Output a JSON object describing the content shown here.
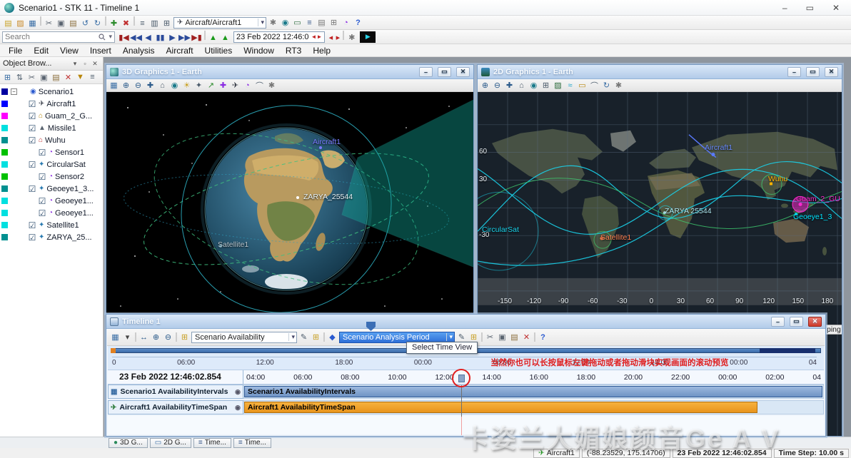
{
  "window": {
    "title": "Scenario1 - STK 11 - Timeline 1"
  },
  "icons": {
    "minimize": "–",
    "maximize": "▭",
    "close": "✕",
    "caret": "▾",
    "aircraft": "✈",
    "search": "Search"
  },
  "menu": {
    "items": [
      "File",
      "Edit",
      "View",
      "Insert",
      "Analysis",
      "Aircraft",
      "Utilities",
      "Window",
      "RT3",
      "Help"
    ]
  },
  "toolbar_top": {
    "object_selector": "Aircraft/Aircraft1",
    "icons_a": [
      {
        "n": "new-scenario-icon",
        "g": "▤",
        "s": "color:#c9a227"
      },
      {
        "n": "open-icon",
        "g": "▨",
        "s": "color:#c98a2a"
      },
      {
        "n": "save-icon",
        "g": "▦",
        "s": "color:#3a6ea5"
      },
      {
        "n": "separator",
        "g": "",
        "s": "min-width:2px;width:2px;height:13px;background:#cdcdcd;margin:0 2px",
        "i": "false"
      },
      {
        "n": "cut-icon",
        "g": "✂",
        "s": "color:#5a6470"
      },
      {
        "n": "copy-icon",
        "g": "▣",
        "s": "color:#5a6470"
      },
      {
        "n": "paste-icon",
        "g": "▤",
        "s": "color:#8a6d3b"
      },
      {
        "n": "undo-icon",
        "g": "↺",
        "s": "color:#3a6ea5"
      },
      {
        "n": "redo-icon",
        "g": "↻",
        "s": "color:#3a6ea5"
      },
      {
        "n": "separator",
        "g": "",
        "s": "min-width:2px;width:2px;height:13px;background:#cdcdcd;margin:0 2px",
        "i": "false"
      },
      {
        "n": "new-object-icon",
        "g": "✚",
        "s": "color:#2a8a2a"
      },
      {
        "n": "delete-object-icon",
        "g": "✖",
        "s": "color:#c03030"
      },
      {
        "n": "separator",
        "g": "",
        "s": "min-width:2px;width:2px;height:13px;background:#cdcdcd;margin:0 2px",
        "i": "false"
      },
      {
        "n": "report-icon",
        "g": "≡",
        "s": "color:#4a5a6a"
      },
      {
        "n": "graph-icon",
        "g": "▥",
        "s": "color:#4a5a6a"
      },
      {
        "n": "browser-icon",
        "g": "⊞",
        "s": "color:#4a5a6a"
      }
    ],
    "icons_b": [
      {
        "n": "properties-icon",
        "g": "✱",
        "s": "color:#777"
      },
      {
        "n": "3d-graphics-icon",
        "g": "◉",
        "s": "color:#1a7a8a"
      },
      {
        "n": "2d-graphics-icon",
        "g": "▭",
        "s": "color:#2a6a3a"
      },
      {
        "n": "timeline-window-icon",
        "g": "≡",
        "s": "color:#3a5a8a"
      },
      {
        "n": "report-manager-icon",
        "g": "▤",
        "s": "color:#777"
      },
      {
        "n": "data-provider-icon",
        "g": "⊞",
        "s": "color:#777"
      },
      {
        "n": "sensor-manager-icon",
        "g": "◔",
        "s": "color:#8a2be2"
      },
      {
        "n": "help-icon",
        "g": "?",
        "s": "color:#2a5ad0;font-weight:bold"
      }
    ]
  },
  "toolbar_anim": {
    "search_value": "Search",
    "time_field": "23 Feb 2022 12:46:0",
    "vcr": [
      {
        "n": "animation-reset-icon",
        "g": "▮◀",
        "s": "color:#a02020"
      },
      {
        "n": "step-back-icon",
        "g": "◀◀",
        "s": "color:#2a4a9a"
      },
      {
        "n": "play-backward-icon",
        "g": "◀",
        "s": "color:#2a4a9a"
      },
      {
        "n": "pause-icon",
        "g": "▮▮",
        "s": "color:#2a4a9a"
      },
      {
        "n": "play-icon",
        "g": "▶",
        "s": "color:#2a4a9a"
      },
      {
        "n": "step-forward-icon",
        "g": "▶▶",
        "s": "color:#2a4a9a"
      },
      {
        "n": "animation-end-icon",
        "g": "▶▮",
        "s": "color:#a02020"
      },
      {
        "n": "separator",
        "g": "",
        "s": "min-width:2px;width:2px;height:13px;background:#cdcdcd;margin:0 2px",
        "i": "false"
      },
      {
        "n": "decrease-step-icon",
        "g": "▲",
        "s": "color:#1a9a1a"
      },
      {
        "n": "increase-step-icon",
        "g": "▲",
        "s": "color:#1a9a1a"
      }
    ],
    "icons_c": [
      {
        "n": "time-step-down-icon",
        "g": "◂",
        "s": "color:#c02020;min-width:10px"
      },
      {
        "n": "time-step-up-icon",
        "g": "▸",
        "s": "color:#c02020;min-width:10px"
      },
      {
        "n": "separator",
        "g": "",
        "s": "min-width:2px;width:2px;height:13px;background:#cdcdcd;margin:0 2px",
        "i": "false"
      },
      {
        "n": "animation-options-icon",
        "g": "✱",
        "s": "color:#777"
      }
    ]
  },
  "object_browser": {
    "title": "Object Brow...",
    "head_icons": [
      {
        "n": "dock-menu-icon",
        "g": "▾"
      },
      {
        "n": "pin-icon",
        "g": "▫"
      },
      {
        "n": "close-icon",
        "g": "✕"
      }
    ],
    "toolbar_icons": [
      {
        "n": "view-mode-icon",
        "g": "⊞",
        "s": "color:#3a6ea5"
      },
      {
        "n": "sort-icon",
        "g": "⇅",
        "s": "color:#4a5a6a"
      },
      {
        "n": "cut-icon",
        "g": "✂",
        "s": "color:#5a6470"
      },
      {
        "n": "copy-icon",
        "g": "▣",
        "s": "color:#5a6470"
      },
      {
        "n": "paste-icon",
        "g": "▤",
        "s": "color:#8a6d3b"
      },
      {
        "n": "delete-icon",
        "g": "✕",
        "s": "color:#c03030"
      },
      {
        "n": "filter-icon",
        "g": "▼",
        "s": "color:#b8860b"
      },
      {
        "n": "list-icon",
        "g": "≡",
        "s": "color:#4a5a6a"
      }
    ],
    "tree": [
      {
        "label": "Scenario1",
        "exp": "−",
        "cb": "",
        "g": "◉",
        "gs": "color:#2a5ad0",
        "chip": "background:#0000a0",
        "pad": "padding-left:1px"
      },
      {
        "label": "Aircraft1",
        "exp": "",
        "cb": "☑",
        "g": "✈",
        "gs": "color:#3a3f4a",
        "chip": "background:#0000ff",
        "pad": "padding-left:13px"
      },
      {
        "label": "Guam_2_G...",
        "exp": "",
        "cb": "☑",
        "g": "⌂",
        "gs": "color:#b8860b",
        "chip": "background:#ff00ff",
        "pad": "padding-left:13px"
      },
      {
        "label": "Missile1",
        "exp": "",
        "cb": "☑",
        "g": "▲",
        "gs": "color:#5a6470",
        "chip": "background:#00e0e0",
        "pad": "padding-left:13px"
      },
      {
        "label": "Wuhu",
        "exp": "",
        "cb": "☑",
        "g": "⌂",
        "gs": "color:#c03030",
        "chip": "background:#009090",
        "pad": "padding-left:13px"
      },
      {
        "label": "Sensor1",
        "exp": "",
        "cb": "☑",
        "g": "◔",
        "gs": "color:#8a2be2",
        "chip": "background:#00c000",
        "pad": "padding-left:27px"
      },
      {
        "label": "CircularSat",
        "exp": "",
        "cb": "☑",
        "g": "✦",
        "gs": "color:#2a7ab0",
        "chip": "background:#00e0e0",
        "pad": "padding-left:13px"
      },
      {
        "label": "Sensor2",
        "exp": "",
        "cb": "☑",
        "g": "◔",
        "gs": "color:#8a2be2",
        "chip": "background:#00c000",
        "pad": "padding-left:27px"
      },
      {
        "label": "Geoeye1_3...",
        "exp": "",
        "cb": "☑",
        "g": "✦",
        "gs": "color:#2a7ab0",
        "chip": "background:#009090",
        "pad": "padding-left:13px"
      },
      {
        "label": "Geoeye1...",
        "exp": "",
        "cb": "☑",
        "g": "◔",
        "gs": "color:#8a2be2",
        "chip": "background:#00e0e0",
        "pad": "padding-left:27px"
      },
      {
        "label": "Geoeye1...",
        "exp": "",
        "cb": "☑",
        "g": "◔",
        "gs": "color:#8a2be2",
        "chip": "background:#00e0e0",
        "pad": "padding-left:27px"
      },
      {
        "label": "Satellite1",
        "exp": "",
        "cb": "☑",
        "g": "✦",
        "gs": "color:#2a7ab0",
        "chip": "background:#00e0e0",
        "pad": "padding-left:13px"
      },
      {
        "label": "ZARYA_25...",
        "exp": "",
        "cb": "☑",
        "g": "✦",
        "gs": "color:#2a7ab0",
        "chip": "background:#009090",
        "pad": "padding-left:13px"
      }
    ]
  },
  "win3d": {
    "title": "3D Graphics 1 - Earth",
    "toolbar_icons": [
      {
        "n": "store-views-icon",
        "g": "▦",
        "s": "color:#3a6ea5"
      },
      {
        "n": "zoom-in-icon",
        "g": "⊕",
        "s": "color:#2a5a8a"
      },
      {
        "n": "zoom-out-icon",
        "g": "⊖",
        "s": "color:#2a5a8a"
      },
      {
        "n": "pan-icon",
        "g": "✚",
        "s": "color:#2a5a8a"
      },
      {
        "n": "home-view-icon",
        "g": "⌂",
        "s": "color:#4a5a6a"
      },
      {
        "n": "globe-icon",
        "g": "◉",
        "s": "color:#1a7a8a"
      },
      {
        "n": "lighting-icon",
        "g": "☀",
        "s": "color:#c9a227"
      },
      {
        "n": "stars-icon",
        "g": "✦",
        "s": "color:#4a5a6a"
      },
      {
        "n": "vectors-icon",
        "g": "↗",
        "s": "color:#2a8a2a"
      },
      {
        "n": "axes-icon",
        "g": "✚",
        "s": "color:#8a2be2"
      },
      {
        "n": "model-icon",
        "g": "✈",
        "s": "color:#3a3f4a"
      },
      {
        "n": "sensor-icon",
        "g": "◔",
        "s": "color:#8a2be2"
      },
      {
        "n": "measure-icon",
        "g": "⌒",
        "s": "color:#4a5a6a"
      },
      {
        "n": "settings-icon",
        "g": "✱",
        "s": "color:#777"
      }
    ],
    "labels": {
      "aircraft": "Aircraft1",
      "zarya": "ZARYA_25544",
      "satellite": "Satellite1"
    }
  },
  "win2d": {
    "title": "2D Graphics 1 - Earth",
    "toolbar_icons": [
      {
        "n": "zoom-in-icon",
        "g": "⊕",
        "s": "color:#2a5a8a"
      },
      {
        "n": "zoom-out-icon",
        "g": "⊖",
        "s": "color:#2a5a8a"
      },
      {
        "n": "pan-icon",
        "g": "✚",
        "s": "color:#2a5a8a"
      },
      {
        "n": "full-extent-icon",
        "g": "⌂",
        "s": "color:#4a5a6a"
      },
      {
        "n": "projection-icon",
        "g": "◉",
        "s": "color:#1a7a8a"
      },
      {
        "n": "grid-icon",
        "g": "⊞",
        "s": "color:#4a5a6a"
      },
      {
        "n": "imagery-icon",
        "g": "▨",
        "s": "color:#2a6a3a"
      },
      {
        "n": "tracks-icon",
        "g": "≈",
        "s": "color:#19a2c8"
      },
      {
        "n": "regions-icon",
        "g": "▭",
        "s": "color:#b8860b"
      },
      {
        "n": "measure-icon",
        "g": "⌒",
        "s": "color:#4a5a6a"
      },
      {
        "n": "refresh-icon",
        "g": "↻",
        "s": "color:#3a6ea5"
      },
      {
        "n": "settings-icon",
        "g": "✱",
        "s": "color:#777"
      }
    ],
    "lat_labels": [
      "60",
      "30",
      "-30"
    ],
    "lon_labels": [
      "-150",
      "-120",
      "-90",
      "-60",
      "-30",
      "0",
      "30",
      "60",
      "90",
      "120",
      "150",
      "180"
    ],
    "labels": {
      "aircraft": "Aircraft1",
      "wuhu": "Wuhu",
      "guam": "Guam_2_GU",
      "geoeye": "Geoeye1_3",
      "zarya": "ZARYA 25544",
      "circularsat": "CircularSat",
      "satellite": "Satellite1"
    },
    "overlay_text": "ping"
  },
  "timeline": {
    "title": "Timeline 1",
    "toolbar_a": [
      {
        "n": "timeline-view-icon",
        "g": "▦",
        "s": "color:#3a6ea5"
      },
      {
        "n": "add-view-icon",
        "g": "▾",
        "s": "color:#444"
      },
      {
        "n": "separator",
        "g": "",
        "s": "min-width:2px;width:2px;height:13px;background:#cdcdcd;margin:0 2px",
        "i": "false"
      },
      {
        "n": "zoom-fit-icon",
        "g": "↔",
        "s": "color:#2a5a8a"
      },
      {
        "n": "zoom-in-icon",
        "g": "⊕",
        "s": "color:#2a5a8a"
      },
      {
        "n": "zoom-out-icon",
        "g": "⊖",
        "s": "color:#2a5a8a"
      },
      {
        "n": "separator",
        "g": "",
        "s": "min-width:2px;width:2px;height:13px;background:#cdcdcd;margin:0 2px",
        "i": "false"
      },
      {
        "n": "time-component-icon",
        "g": "⊞",
        "s": "color:#c9a227"
      }
    ],
    "combo_time_component": "Scenario Availability",
    "toolbar_b": [
      {
        "n": "edit-time-component-icon",
        "g": "✎",
        "s": "color:#4a5a6a"
      },
      {
        "n": "add-time-component-icon",
        "g": "⊞",
        "s": "color:#c9a227"
      },
      {
        "n": "separator",
        "g": "",
        "s": "min-width:2px;width:2px;height:13px;background:#cdcdcd;margin:0 2px",
        "i": "false"
      },
      {
        "n": "time-view-icon",
        "g": "◆",
        "s": "color:#2a5ad0"
      }
    ],
    "combo_time_view": "Scenario Analysis Period",
    "toolbar_c": [
      {
        "n": "edit-time-view-icon",
        "g": "✎",
        "s": "color:#4a5a6a"
      },
      {
        "n": "add-time-view-icon",
        "g": "⊞",
        "s": "color:#c9a227"
      },
      {
        "n": "separator",
        "g": "",
        "s": "min-width:2px;width:2px;height:13px;background:#cdcdcd;margin:0 2px",
        "i": "false"
      },
      {
        "n": "cut-icon",
        "g": "✂",
        "s": "color:#5a6470"
      },
      {
        "n": "copy-icon",
        "g": "▣",
        "s": "color:#5a6470"
      },
      {
        "n": "paste-icon",
        "g": "▤",
        "s": "color:#8a6d3b"
      },
      {
        "n": "delete-icon",
        "g": "✕",
        "s": "color:#c03030"
      },
      {
        "n": "separator",
        "g": "",
        "s": "min-width:2px;width:2px;height:13px;background:#cdcdcd;margin:0 2px",
        "i": "false"
      },
      {
        "n": "help-icon",
        "g": "?",
        "s": "color:#2a5ad0;font-weight:bold"
      }
    ],
    "tooltip": "Select Time View",
    "annotation_text": "当然你也可以长按鼠标左键拖动或者拖动滑块实现画面的滚动预览",
    "overview_ticks": [
      "0",
      "06:00",
      "12:00",
      "18:00",
      "00:00",
      "06:00",
      "12:00",
      "18:00",
      "00:00",
      "04"
    ],
    "current_time": "23 Feb 2022 12:46:02.854",
    "detail_ticks": [
      "04:00",
      "06:00",
      "08:00",
      "10:00",
      "12:00",
      "14:00",
      "16:00",
      "18:00",
      "20:00",
      "22:00",
      "00:00",
      "02:00",
      "04"
    ],
    "rows": [
      {
        "label": "Scenario1 AvailabilityIntervals",
        "icon": "▦",
        "is": "color:#3a6ea5",
        "eye": "◉",
        "bar": "Scenario1 AvailabilityIntervals"
      },
      {
        "label": "Aircraft1 AvailabilityTimeSpan",
        "icon": "✈",
        "is": "color:#2a7a3a",
        "eye": "◉",
        "bar": "Aircraft1 AvailabilityTimeSpan"
      }
    ]
  },
  "taskbar": {
    "tabs": [
      {
        "label": "3D G...",
        "g": "●",
        "s": "color:#2a8a5a"
      },
      {
        "label": "2D G...",
        "g": "▭",
        "s": "color:#3a6ea5"
      },
      {
        "label": "Time...",
        "g": "≡",
        "s": "color:#3a5a8a"
      },
      {
        "label": "Time...",
        "g": "≡",
        "s": "color:#3a5a8a"
      }
    ]
  },
  "statusbar": {
    "object_label": "Aircraft1",
    "coordinates": "(-88.23529, 175.14706)",
    "time": "23 Feb 2022 12:46:02.854",
    "time_step": "Time Step: 10.00 s"
  },
  "watermark": "卡姿兰大媚娘颜音Ge A V"
}
